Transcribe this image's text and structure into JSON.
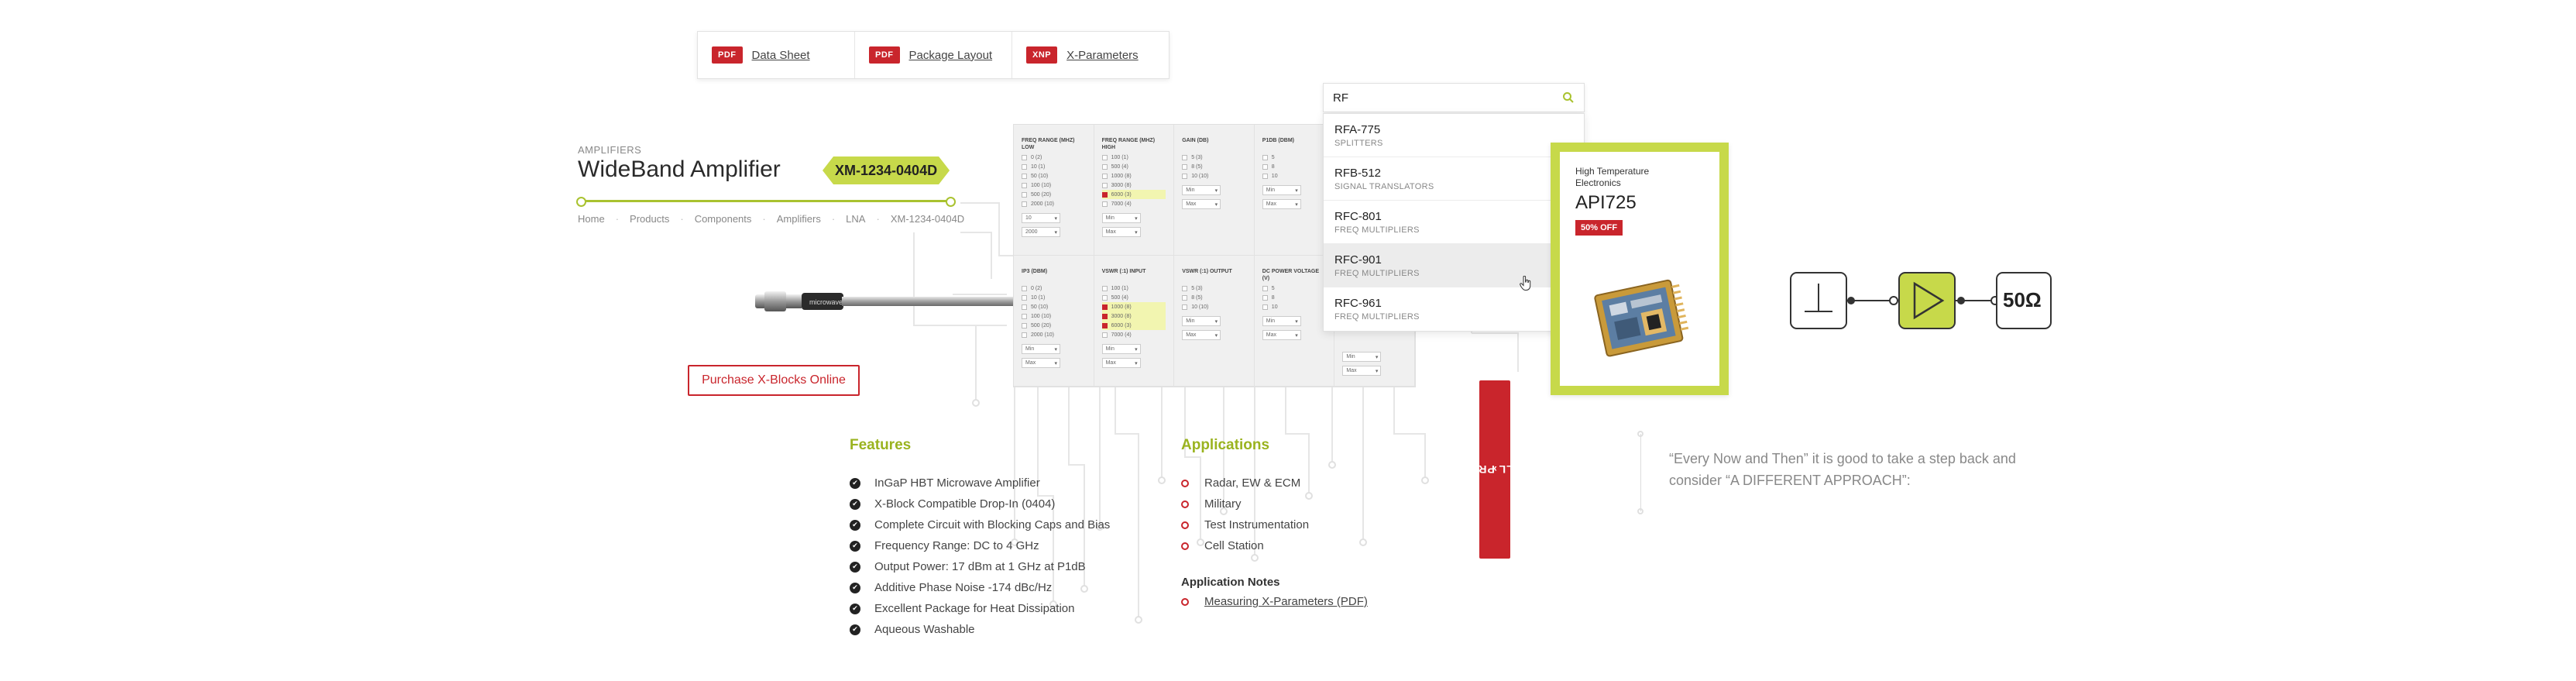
{
  "documents": [
    {
      "badge": "PDF",
      "label": "Data Sheet"
    },
    {
      "badge": "PDF",
      "label": "Package Layout"
    },
    {
      "badge": "XNP",
      "label": "X-Parameters"
    }
  ],
  "product": {
    "category": "AMPLIFIERS",
    "title": "WideBand Amplifier",
    "sku": "XM-1234-0404D"
  },
  "breadcrumb": [
    "Home",
    "Products",
    "Components",
    "Amplifiers",
    "LNA",
    "XM-1234-0404D"
  ],
  "purchase_button": "Purchase X-Blocks Online",
  "filters": {
    "row1": [
      {
        "title": "FREQ RANGE (MHZ) LOW",
        "options": [
          {
            "label": "0 (2)",
            "on": false
          },
          {
            "label": "10 (1)",
            "on": false
          },
          {
            "label": "50 (10)",
            "on": false
          },
          {
            "label": "100 (10)",
            "on": false
          },
          {
            "label": "500 (20)",
            "on": false
          },
          {
            "label": "2000 (10)",
            "on": false
          }
        ],
        "selects": [
          "10",
          "2000"
        ]
      },
      {
        "title": "FREQ RANGE (MHZ) HIGH",
        "options": [
          {
            "label": "100 (1)",
            "on": false
          },
          {
            "label": "500 (4)",
            "on": false
          },
          {
            "label": "1000 (8)",
            "on": false
          },
          {
            "label": "3000 (8)",
            "on": false
          },
          {
            "label": "6000 (3)",
            "on": true
          },
          {
            "label": "7000 (4)",
            "on": false
          }
        ],
        "selects": [
          "Min",
          "Max"
        ]
      },
      {
        "title": "GAIN (DB)",
        "options": [
          {
            "label": "5 (3)",
            "on": false
          },
          {
            "label": "8 (5)",
            "on": false
          },
          {
            "label": "10 (10)",
            "on": false
          }
        ],
        "selects": [
          "Min",
          "Max"
        ]
      },
      {
        "title": "P1DB (DBM)",
        "options": [
          {
            "label": "5",
            "on": false
          },
          {
            "label": "8",
            "on": false
          },
          {
            "label": "10",
            "on": false
          }
        ],
        "selects": [
          "Min",
          "Max"
        ]
      },
      {
        "title": "",
        "options": [],
        "selects": []
      }
    ],
    "row2": [
      {
        "title": "IP3 (DBM)",
        "options": [
          {
            "label": "0 (2)",
            "on": false
          },
          {
            "label": "10 (1)",
            "on": false
          },
          {
            "label": "50 (10)",
            "on": false
          },
          {
            "label": "100 (10)",
            "on": false
          },
          {
            "label": "500 (20)",
            "on": false
          },
          {
            "label": "2000 (10)",
            "on": false
          }
        ],
        "selects": [
          "Min",
          "Max"
        ]
      },
      {
        "title": "VSWR (:1) INPUT",
        "options": [
          {
            "label": "100 (1)",
            "on": false
          },
          {
            "label": "500 (4)",
            "on": false
          },
          {
            "label": "1000 (8)",
            "on": true
          },
          {
            "label": "3000 (8)",
            "on": true
          },
          {
            "label": "6000 (3)",
            "on": true
          },
          {
            "label": "7000 (4)",
            "on": false
          }
        ],
        "selects": [
          "Min",
          "Max"
        ]
      },
      {
        "title": "VSWR (:1) OUTPUT",
        "options": [
          {
            "label": "5 (3)",
            "on": false
          },
          {
            "label": "8 (5)",
            "on": false
          },
          {
            "label": "10 (10)",
            "on": false
          }
        ],
        "selects": [
          "Min",
          "Max"
        ]
      },
      {
        "title": "DC POWER VOLTAGE (V)",
        "options": [
          {
            "label": "5",
            "on": false
          },
          {
            "label": "8",
            "on": false
          },
          {
            "label": "10",
            "on": false
          }
        ],
        "selects": [
          "Min",
          "Max"
        ]
      },
      {
        "title": "",
        "options": [],
        "selects": [
          "Min",
          "Max"
        ]
      }
    ]
  },
  "search": {
    "value": "RF",
    "results": [
      {
        "code": "RFA-775",
        "category": "SPLITTERS"
      },
      {
        "code": "RFB-512",
        "category": "SIGNAL TRANSLATORS"
      },
      {
        "code": "RFC-801",
        "category": "FREQ MULTIPLIERS"
      },
      {
        "code": "RFC-901",
        "category": "FREQ MULTIPLIERS"
      },
      {
        "code": "RFC-961",
        "category": "FREQ MULTIPLIERS"
      }
    ]
  },
  "show_all": "SHOW ALL PRODUCTS",
  "promo": {
    "label": "High Temperature Electronics",
    "name": "API725",
    "badge": "50% OFF"
  },
  "schematic": {
    "load": "50Ω"
  },
  "features": {
    "title": "Features",
    "items": [
      "InGaP HBT Microwave Amplifier",
      "X-Block Compatible Drop-In (0404)",
      "Complete Circuit with Blocking Caps and Bias",
      "Frequency Range: DC to 4 GHz",
      "Output Power: 17 dBm at 1 GHz at P1dB",
      "Additive Phase Noise -174 dBc/Hz",
      "Excellent Package for Heat Dissipation",
      "Aqueous Washable"
    ]
  },
  "applications": {
    "title": "Applications",
    "items": [
      "Radar, EW & ECM",
      "Military",
      "Test Instrumentation",
      "Cell Station"
    ],
    "notes_title": "Application Notes",
    "notes": [
      "Measuring X-Parameters (PDF)"
    ]
  },
  "quote": "“Every Now and Then” it is good to take a step back and consider “A DIFFERENT APPROACH”:",
  "colors": {
    "accent": "#c7d94a",
    "brand_red": "#c9252c",
    "green_text": "#9ab31f"
  }
}
